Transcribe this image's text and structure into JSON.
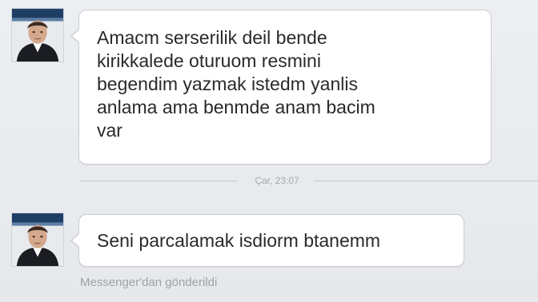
{
  "messages": [
    {
      "text": "Amacm serserilik deil bende\nkirikkalede oturuom resmini\nbegendim yazmak istedm yanlis\nanlama ama benmde anam bacim\nvar"
    },
    {
      "text": "Seni parcalamak isdiorm btanemm"
    }
  ],
  "timestamp": "Çar, 23:07",
  "sent_via": "Messenger'dan gönderildi",
  "colors": {
    "background": "#e9eaee",
    "bubble": "#ffffff",
    "bubble_border": "#c9ccd3",
    "text": "#2a2a2c",
    "muted": "#9ea1a7"
  }
}
